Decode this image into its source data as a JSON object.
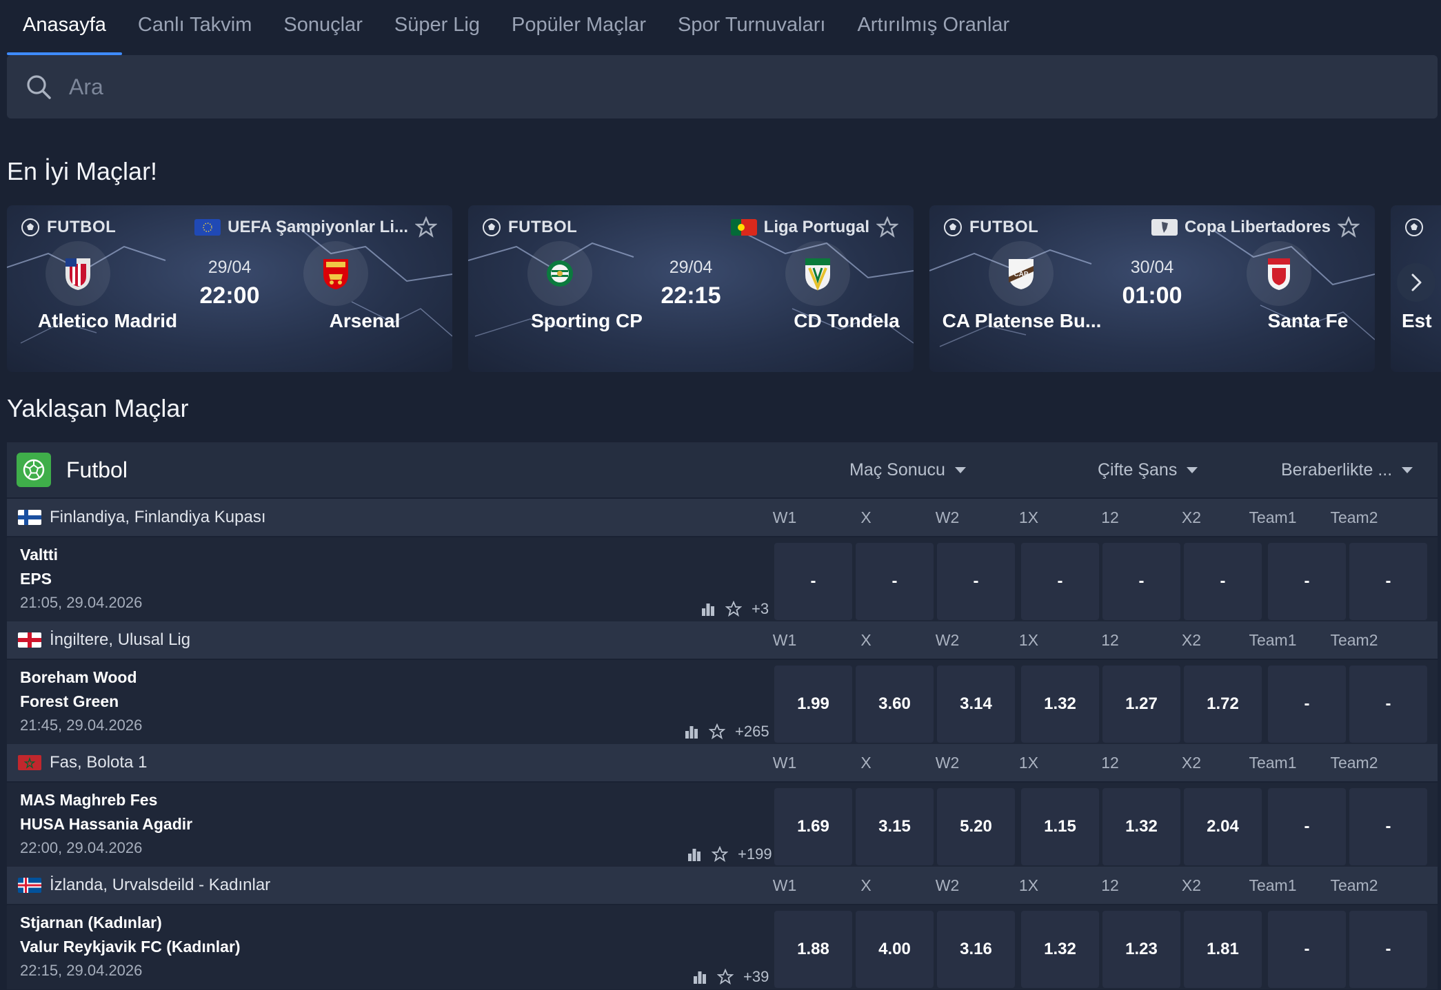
{
  "nav": {
    "tabs": [
      {
        "label": "Anasayfa",
        "active": true
      },
      {
        "label": "Canlı Takvim"
      },
      {
        "label": "Sonuçlar"
      },
      {
        "label": "Süper Lig"
      },
      {
        "label": "Popüler Maçlar"
      },
      {
        "label": "Spor Turnuvaları"
      },
      {
        "label": "Artırılmış Oranlar"
      }
    ]
  },
  "search": {
    "placeholder": "Ara",
    "icon": "search-icon"
  },
  "top_matches": {
    "title": "En İyi Maçlar!",
    "cards": [
      {
        "sport": "FUTBOL",
        "league": "UEFA Şampiyonlar Li...",
        "home": "Atletico Madrid",
        "away": "Arsenal",
        "date": "29/04",
        "time": "22:00"
      },
      {
        "sport": "FUTBOL",
        "league": "Liga Portugal",
        "home": "Sporting CP",
        "away": "CD Tondela",
        "date": "29/04",
        "time": "22:15"
      },
      {
        "sport": "FUTBOL",
        "league": "Copa Libertadores",
        "home": "CA Platense Bu...",
        "away": "Santa Fe",
        "date": "30/04",
        "time": "01:00"
      },
      {
        "home": "Est"
      }
    ]
  },
  "upcoming": {
    "title": "Yaklaşan Maçlar",
    "sport": "Futbol",
    "markets": [
      "Maç Sonucu",
      "Çifte Şans",
      "Beraberlikte ..."
    ],
    "columns": [
      "W1",
      "X",
      "W2",
      "1X",
      "12",
      "X2",
      "Team1",
      "Team2"
    ],
    "leagues": [
      {
        "name": "Finlandiya, Finlandiya Kupası",
        "match": {
          "home": "Valtti",
          "away": "EPS",
          "time": "21:05, 29.04.2026",
          "more": "+3",
          "odds": [
            "-",
            "-",
            "-",
            "-",
            "-",
            "-",
            "-",
            "-"
          ]
        }
      },
      {
        "name": "İngiltere, Ulusal Lig",
        "match": {
          "home": "Boreham Wood",
          "away": "Forest Green",
          "time": "21:45, 29.04.2026",
          "more": "+265",
          "odds": [
            "1.99",
            "3.60",
            "3.14",
            "1.32",
            "1.27",
            "1.72",
            "-",
            "-"
          ]
        }
      },
      {
        "name": "Fas, Bolota 1",
        "match": {
          "home": "MAS Maghreb Fes",
          "away": "HUSA Hassania Agadir",
          "time": "22:00, 29.04.2026",
          "more": "+199",
          "odds": [
            "1.69",
            "3.15",
            "5.20",
            "1.15",
            "1.32",
            "2.04",
            "-",
            "-"
          ]
        }
      },
      {
        "name": "İzlanda, Urvalsdeild - Kadınlar",
        "match": {
          "home": "Stjarnan (Kadınlar)",
          "away": "Valur Reykjavik FC (Kadınlar)",
          "time": "22:15, 29.04.2026",
          "more": "+39",
          "odds": [
            "1.88",
            "4.00",
            "3.16",
            "1.32",
            "1.23",
            "1.81",
            "-",
            "-"
          ]
        }
      }
    ]
  },
  "colors": {
    "background": "#1a2233",
    "accent": "#3e8bff",
    "sport_icon": "#3fae4a"
  }
}
